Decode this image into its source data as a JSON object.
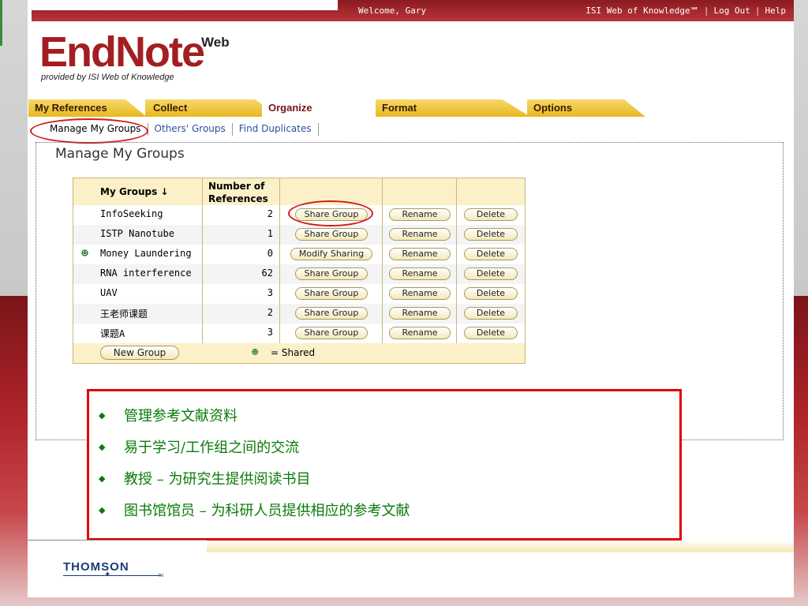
{
  "topbar": {
    "welcome": "Welcome, Gary",
    "links": [
      "ISI Web of Knowledge℠",
      "Log Out",
      "Help"
    ]
  },
  "logo": {
    "name": "EndNote",
    "suffix": "Web",
    "tagline": "provided by ISI Web of Knowledge"
  },
  "tabs": [
    "My References",
    "Collect",
    "Organize",
    "Format",
    "Options"
  ],
  "active_tab": "Organize",
  "subnav": [
    "Manage My Groups",
    "Others' Groups",
    "Find Duplicates"
  ],
  "page_title": "Manage My Groups",
  "table": {
    "headers": {
      "groups": "My Groups ↓",
      "refs_line1": "Number of",
      "refs_line2": "References"
    },
    "rows": [
      {
        "name": "InfoSeeking",
        "count": "2",
        "share": "Share Group",
        "rename": "Rename",
        "delete": "Delete"
      },
      {
        "name": "ISTP Nanotube",
        "count": "1",
        "share": "Share Group",
        "rename": "Rename",
        "delete": "Delete"
      },
      {
        "name": "Money Laundering",
        "count": "0",
        "share": "Modify Sharing",
        "rename": "Rename",
        "delete": "Delete",
        "shared": true
      },
      {
        "name": "RNA interference",
        "count": "62",
        "share": "Share Group",
        "rename": "Rename",
        "delete": "Delete"
      },
      {
        "name": "UAV",
        "count": "3",
        "share": "Share Group",
        "rename": "Rename",
        "delete": "Delete"
      },
      {
        "name": "王老师课题",
        "count": "2",
        "share": "Share Group",
        "rename": "Rename",
        "delete": "Delete"
      },
      {
        "name": "课题A",
        "count": "3",
        "share": "Share Group",
        "rename": "Rename",
        "delete": "Delete"
      }
    ],
    "new_group": "New Group",
    "shared_legend": "= Shared"
  },
  "notes": [
    "管理参考文献资料",
    "易于学习/工作组之间的交流",
    "教授 – 为研究生提供阅读书目",
    "图书馆馆员 – 为科研人员提供相应的参考文献"
  ],
  "footer": {
    "brand": "THOMSON",
    "tm": "TM"
  },
  "colors": {
    "brand_red": "#a31e22",
    "tab_gold": "#e8b820",
    "note_green": "#0a7a0a",
    "highlight_red": "#d41c1c"
  }
}
